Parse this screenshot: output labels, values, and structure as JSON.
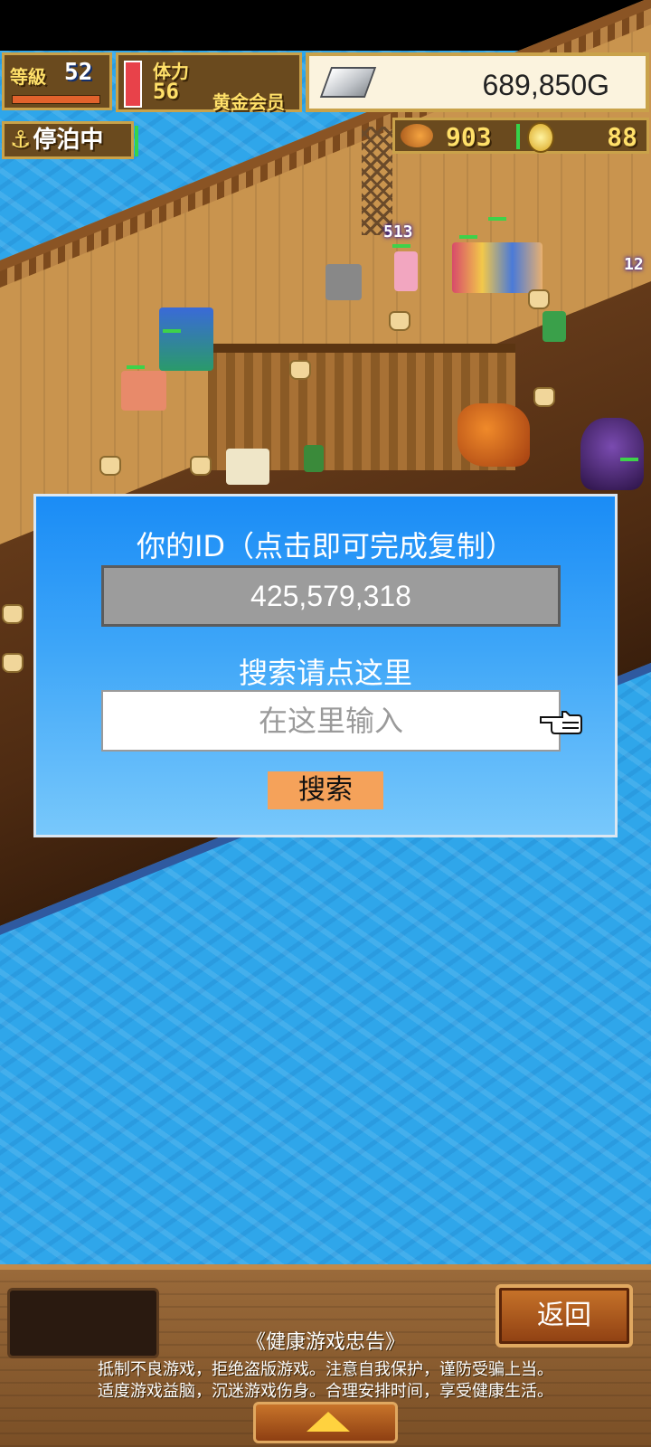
{
  "hud": {
    "level_label": "等級",
    "level_value": "52",
    "stamina_label": "体力",
    "stamina_value": "56",
    "membership": "黄金会员",
    "gold": "689,850G",
    "docked_status": "停泊中",
    "food": "903",
    "coins": "88"
  },
  "scene": {
    "damage_number": "513",
    "damage_number_2": "12"
  },
  "dialog": {
    "title": "你的ID（点击即可完成复制）",
    "user_id": "425,579,318",
    "search_label": "搜索请点这里",
    "search_placeholder": "在这里输入",
    "search_button": "搜索"
  },
  "bottom": {
    "back_button": "返回",
    "notice_title": "《健康游戏忠告》",
    "notice_line1": "抵制不良游戏，拒绝盗版游戏。注意自我保护，谨防受骗上当。",
    "notice_line2": "适度游戏益脑，沉迷游戏伤身。合理安排时间，享受健康生活。"
  },
  "icons": {
    "anchor": "⚓",
    "pointer": "hand-pointer-icon",
    "up": "triangle-up-icon"
  }
}
